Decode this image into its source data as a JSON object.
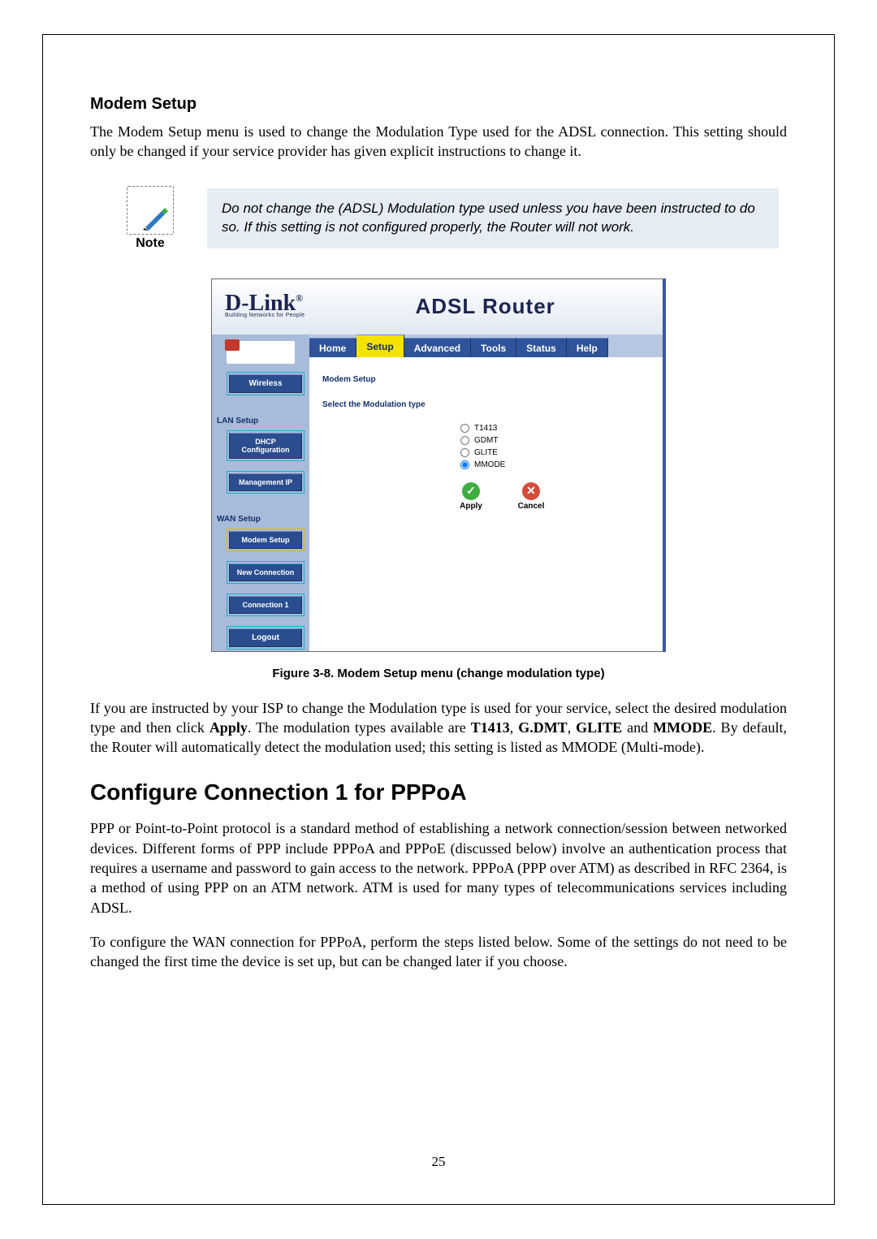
{
  "heading_modem_setup": "Modem Setup",
  "intro_para": "The Modem Setup menu is used to change the Modulation Type used for the ADSL connection. This setting should only be changed if your service provider has given explicit instructions to change it.",
  "note_label": "Note",
  "note_text": "Do not change the (ADSL) Modulation type used unless you have been instructed to do so. If this setting is not configured properly, the Router will not work.",
  "router": {
    "logo_main": "D-Link",
    "logo_tag": "Building Networks for People",
    "title": "ADSL Router",
    "tabs": [
      "Home",
      "Setup",
      "Advanced",
      "Tools",
      "Status",
      "Help"
    ],
    "active_tab_index": 1,
    "sidebar": {
      "btn_wireless": "Wireless",
      "section_lan": "LAN Setup",
      "btn_dhcp": "DHCP Configuration",
      "btn_mgmt": "Management IP",
      "section_wan": "WAN Setup",
      "btn_modem": "Modem Setup",
      "btn_newconn": "New Connection",
      "btn_conn1": "Connection 1",
      "btn_logout": "Logout"
    },
    "panel": {
      "title": "Modem Setup",
      "subtitle": "Select the Modulation type",
      "options": [
        "T1413",
        "GDMT",
        "GLITE",
        "MMODE"
      ],
      "selected_index": 3,
      "apply_label": "Apply",
      "cancel_label": "Cancel"
    }
  },
  "figure_caption": "Figure 3-8. Modem Setup menu (change modulation type)",
  "post_figure_para_parts": {
    "p1": "If you are instructed by your ISP to change the Modulation type is used for your service, select the desired modulation type and then click ",
    "b1": "Apply",
    "p2": ". The modulation types available are ",
    "b2": "T1413",
    "p3": ", ",
    "b3": "G.DMT",
    "p4": ", ",
    "b4": "GLITE",
    "p5": " and ",
    "b5": "MMODE",
    "p6": ". By default, the Router will automatically detect the modulation used; this setting is listed as MMODE (Multi-mode)."
  },
  "heading_pppoa": "Configure Connection 1 for PPPoA",
  "pppoa_para1": "PPP or Point-to-Point protocol is a standard method of establishing a network connection/session between networked devices. Different forms of PPP include PPPoA and PPPoE (discussed below) involve an authentication process that requires a username and password to gain access to the network. PPPoA (PPP over ATM) as described in RFC 2364, is a method of using PPP on an ATM network. ATM is used for many types of telecommunications services including ADSL.",
  "pppoa_para2": "To configure the WAN connection for PPPoA, perform the steps listed below. Some of the settings do not need to be changed the first time the device is set up, but can be changed later if you choose.",
  "page_number": "25"
}
